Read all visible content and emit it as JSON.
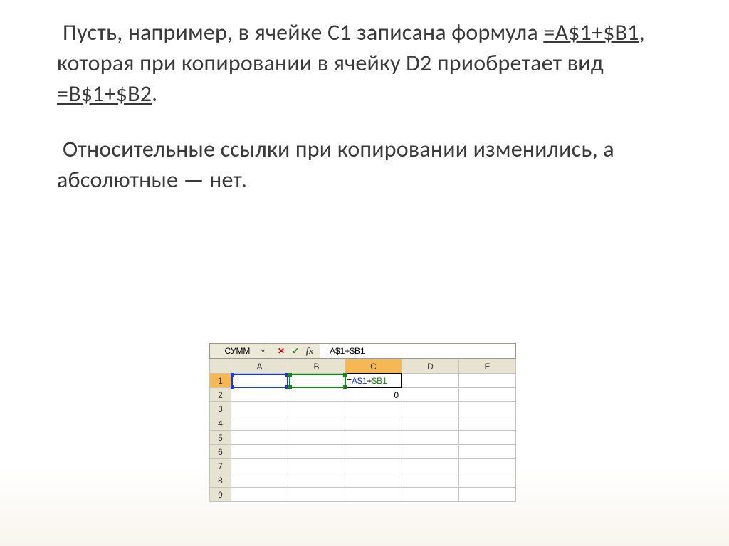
{
  "paragraph1": {
    "t1": " Пусть, например, в ячейке С1 записана формула ",
    "f1": "=А$1+$В1",
    "t2": ", которая при копировании в ячейку D2 приобретает вид ",
    "f2": "=В$1+$В2",
    "t3": "."
  },
  "paragraph2": " Относительные ссылки при копировании изменились, а абсолютные — нет.",
  "spreadsheet": {
    "name_box": "СУММ",
    "fx_label": "fx",
    "formula_plain": "=A$1+$B1",
    "formula_parts": {
      "eq": "=",
      "a1": "A$1",
      "plus": "+",
      "b1": "$B1"
    },
    "columns": [
      "A",
      "B",
      "C",
      "D",
      "E"
    ],
    "rows": [
      "1",
      "2",
      "3",
      "4",
      "5",
      "6",
      "7",
      "8",
      "9"
    ],
    "c1_display": "=A$1+$B1",
    "c2_value": "0"
  }
}
